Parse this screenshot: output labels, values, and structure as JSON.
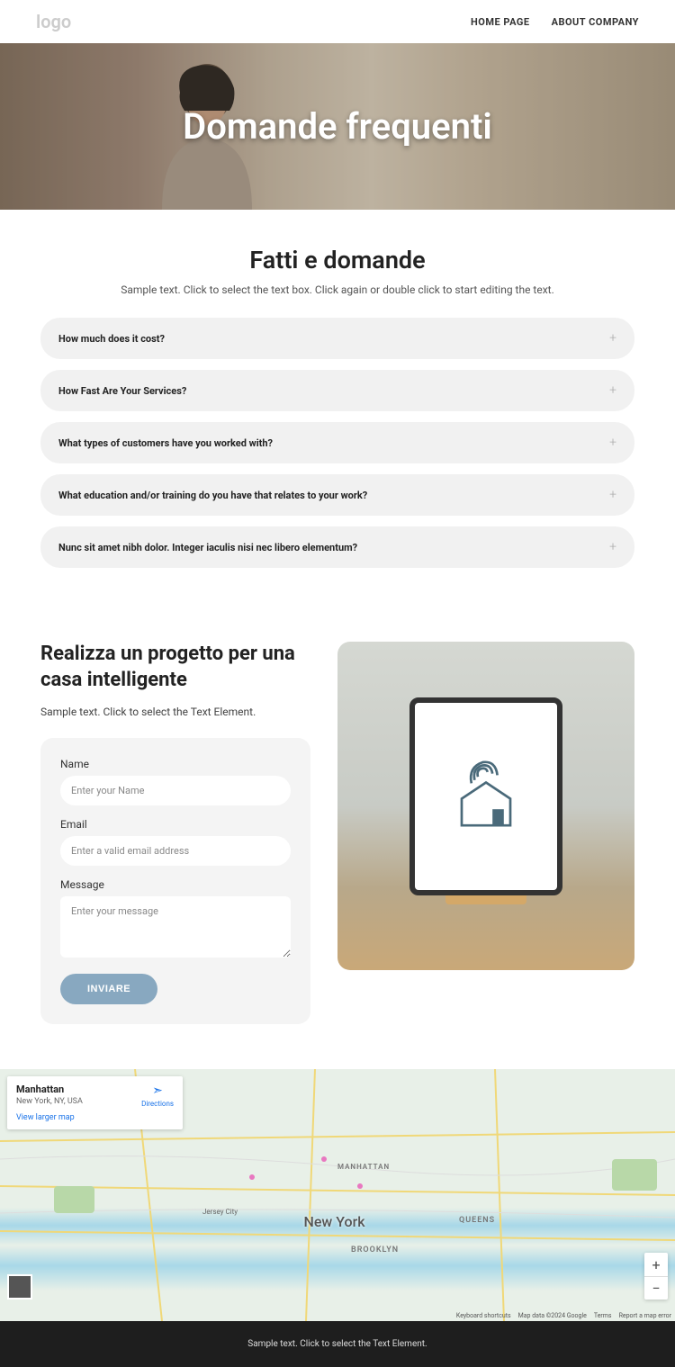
{
  "header": {
    "logo": "logo",
    "nav": {
      "home": "HOME PAGE",
      "about": "ABOUT COMPANY"
    }
  },
  "hero": {
    "title": "Domande frequenti"
  },
  "faq": {
    "heading": "Fatti e domande",
    "subtitle": "Sample text. Click to select the text box. Click again or double click to start editing the text.",
    "items": [
      "How much does it cost?",
      "How Fast Are Your Services?",
      "What types of customers have you worked with?",
      "What education and/or training do you have that relates to your work?",
      "Nunc sit amet nibh dolor. Integer iaculis nisi nec libero elementum?"
    ]
  },
  "project": {
    "title": "Realizza un progetto per una casa intelligente",
    "subtitle": "Sample text. Click to select the Text Element.",
    "form": {
      "name_label": "Name",
      "name_placeholder": "Enter your Name",
      "email_label": "Email",
      "email_placeholder": "Enter a valid email address",
      "message_label": "Message",
      "message_placeholder": "Enter your message",
      "submit": "INVIARE"
    }
  },
  "map": {
    "card": {
      "title": "Manhattan",
      "address": "New York, NY, USA",
      "directions": "Directions",
      "larger": "View larger map"
    },
    "labels": {
      "newyork": "New York",
      "brooklyn": "BROOKLYN",
      "queens": "QUEENS",
      "manhattan": "MANHATTAN",
      "jerseycity": "Jersey City"
    },
    "attribution": {
      "shortcuts": "Keyboard shortcuts",
      "data": "Map data ©2024 Google",
      "terms": "Terms",
      "report": "Report a map error"
    }
  },
  "footer": {
    "text": "Sample text. Click to select the Text Element."
  }
}
